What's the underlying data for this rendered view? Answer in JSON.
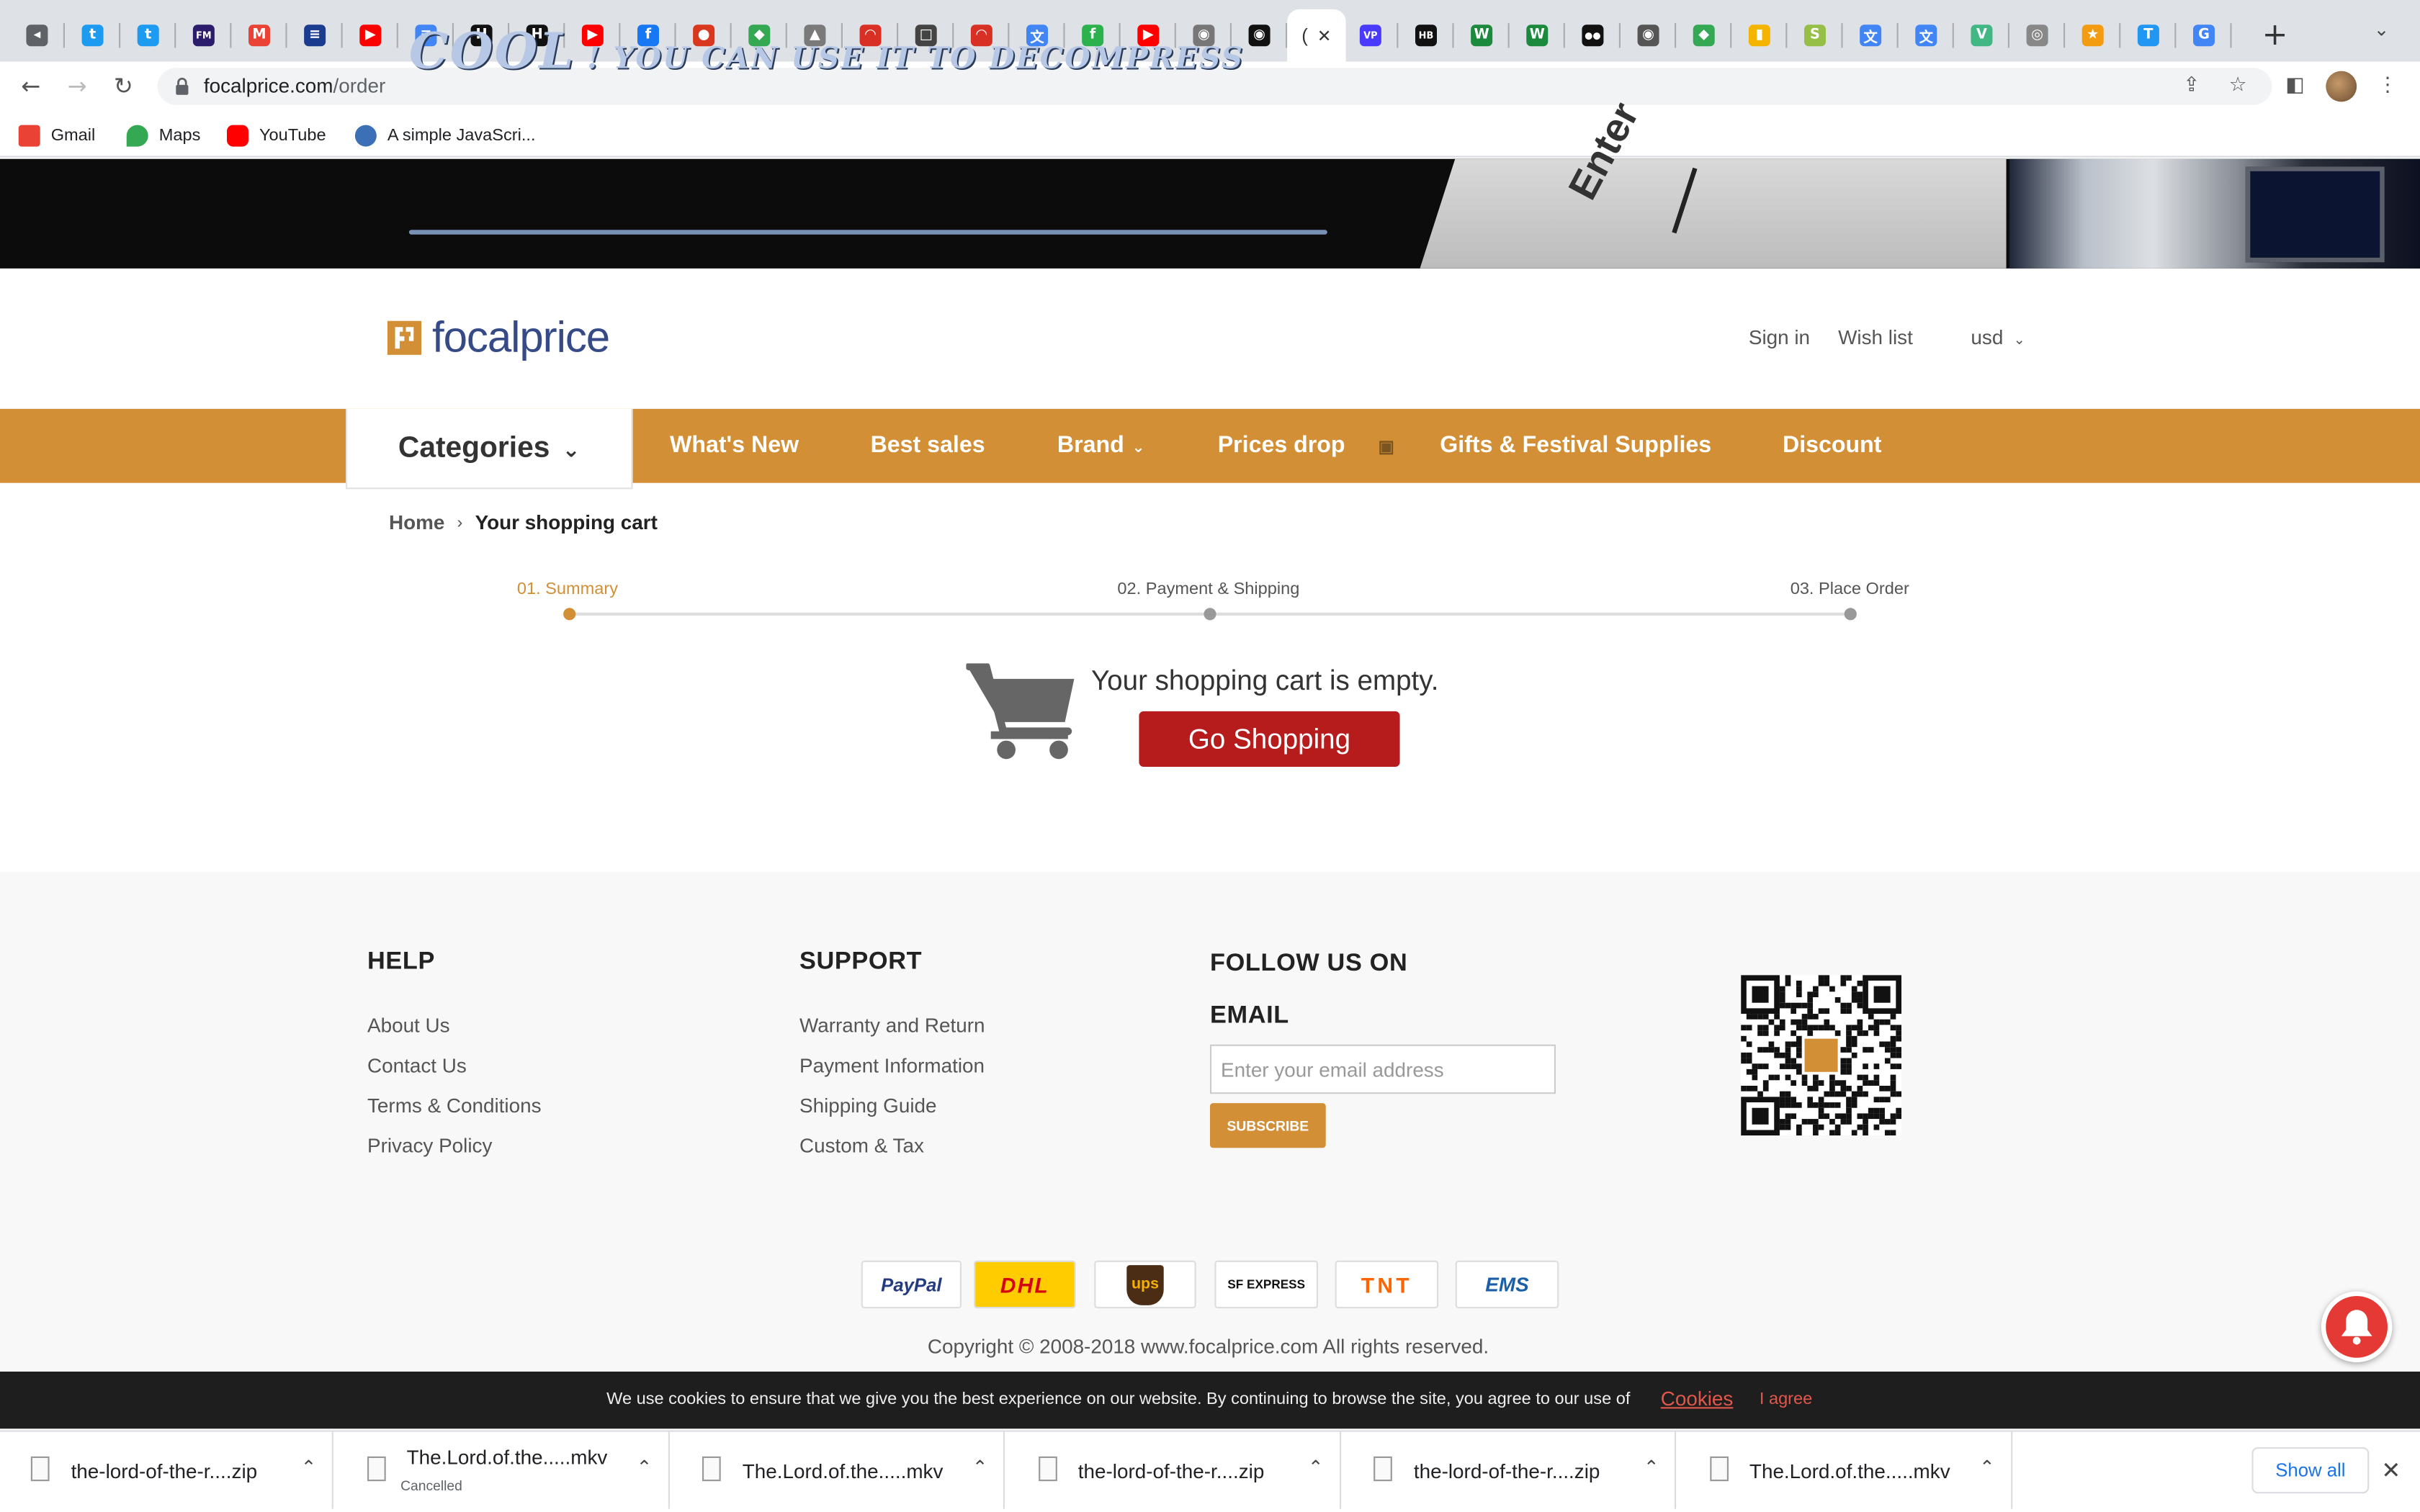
{
  "browser": {
    "url_domain": "focalprice.com",
    "url_path": "/order",
    "active_tab_label": "(",
    "tab_strip_first_label": "(",
    "new_tab_glyph": "+",
    "tab_menu_glyph": "⌄",
    "bookmarks": [
      {
        "label": "Gmail",
        "color": "#ea4335"
      },
      {
        "label": "Maps",
        "color": "#34a853"
      },
      {
        "label": "YouTube",
        "color": "#ff0000"
      },
      {
        "label": "A simple JavaScri...",
        "color": "#3b6fb6"
      }
    ],
    "tabs": [
      {
        "icon": "mute-icon",
        "color": "#5f6368",
        "glyph": "◂"
      },
      {
        "icon": "twitter-icon",
        "color": "#1d9bf0",
        "glyph": "t"
      },
      {
        "icon": "twitter-icon",
        "color": "#1d9bf0",
        "glyph": "t"
      },
      {
        "icon": "fm-icon",
        "color": "#2b1d6b",
        "glyph": "FM"
      },
      {
        "icon": "gmail-icon",
        "color": "#ea4335",
        "glyph": "M"
      },
      {
        "icon": "bank-icon",
        "color": "#1b3b8f",
        "glyph": "≡"
      },
      {
        "icon": "youtube-icon",
        "color": "#ff0000",
        "glyph": "▶"
      },
      {
        "icon": "docs-icon",
        "color": "#4285f4",
        "glyph": "≡"
      },
      {
        "icon": "hackernoon-icon",
        "color": "#111111",
        "glyph": "H"
      },
      {
        "icon": "hackernoon-icon",
        "color": "#111111",
        "glyph": "H"
      },
      {
        "icon": "youtube-icon",
        "color": "#ff0000",
        "glyph": "▶"
      },
      {
        "icon": "facebook-icon",
        "color": "#1877f2",
        "glyph": "f"
      },
      {
        "icon": "manutd-icon",
        "color": "#d9381e",
        "glyph": "●"
      },
      {
        "icon": "maps-icon",
        "color": "#34a853",
        "glyph": "◆"
      },
      {
        "icon": "image-icon",
        "color": "#7a7a7a",
        "glyph": "▲"
      },
      {
        "icon": "speedometer-icon",
        "color": "#d93025",
        "glyph": "◠"
      },
      {
        "icon": "square-icon",
        "color": "#444444",
        "glyph": "□"
      },
      {
        "icon": "speedometer-icon",
        "color": "#d93025",
        "glyph": "◠"
      },
      {
        "icon": "translate-icon",
        "color": "#4285f4",
        "glyph": "文"
      },
      {
        "icon": "feedly-icon",
        "color": "#2bb24c",
        "glyph": "f"
      },
      {
        "icon": "youtube-icon",
        "color": "#ff0000",
        "glyph": "▶"
      },
      {
        "icon": "globe-icon",
        "color": "#777777",
        "glyph": "◉"
      },
      {
        "icon": "github-icon",
        "color": "#111111",
        "glyph": "◉"
      },
      {
        "icon": "active-tab",
        "color": "#ffffff",
        "glyph": "("
      },
      {
        "icon": "vp-icon",
        "color": "#4a3aff",
        "glyph": "VP"
      },
      {
        "icon": "hb-icon",
        "color": "#111111",
        "glyph": "HB"
      },
      {
        "icon": "w-icon",
        "color": "#1c8a3c",
        "glyph": "W"
      },
      {
        "icon": "w-icon",
        "color": "#1c8a3c",
        "glyph": "W"
      },
      {
        "icon": "medium-icon",
        "color": "#111111",
        "glyph": "●●"
      },
      {
        "icon": "globe-icon",
        "color": "#555555",
        "glyph": "◉"
      },
      {
        "icon": "maps-icon",
        "color": "#34a853",
        "glyph": "◆"
      },
      {
        "icon": "shopping-bag-icon",
        "color": "#f4b400",
        "glyph": "▮"
      },
      {
        "icon": "shopify-icon",
        "color": "#95bf47",
        "glyph": "S"
      },
      {
        "icon": "translate-icon",
        "color": "#4285f4",
        "glyph": "文"
      },
      {
        "icon": "translate-icon",
        "color": "#4285f4",
        "glyph": "文"
      },
      {
        "icon": "vuejs-icon",
        "color": "#41b883",
        "glyph": "V"
      },
      {
        "icon": "video-icon",
        "color": "#888888",
        "glyph": "◎"
      },
      {
        "icon": "star-icon",
        "color": "#f39c12",
        "glyph": "★"
      },
      {
        "icon": "t-icon",
        "color": "#2196f3",
        "glyph": "T"
      },
      {
        "icon": "google-icon",
        "color": "#4285f4",
        "glyph": "G"
      }
    ]
  },
  "banner": {
    "headline_big": "COOL",
    "headline_rest": " !  YOU CAN USE IT TO DECOMPRESS",
    "key_label": "Enter"
  },
  "header": {
    "logo_text": "focalprice",
    "sign_in": "Sign in",
    "wish_list": "Wish list",
    "currency": "usd"
  },
  "nav": {
    "categories": "Categories",
    "items": [
      "What's New",
      "Best sales",
      "Brand",
      "Prices drop",
      "Gifts & Festival Supplies",
      "Discount"
    ]
  },
  "breadcrumb": {
    "home": "Home",
    "current": "Your shopping cart"
  },
  "steps": {
    "current_index": 0,
    "items": [
      "01. Summary",
      "02. Payment & Shipping",
      "03. Place Order"
    ],
    "active_color": "#d38f35"
  },
  "cart": {
    "empty_message": "Your shopping cart is empty.",
    "go_shopping": "Go Shopping"
  },
  "footer": {
    "help": {
      "heading": "HELP",
      "links": [
        "About Us",
        "Contact Us",
        "Terms & Conditions",
        "Privacy Policy"
      ]
    },
    "support": {
      "heading": "SUPPORT",
      "links": [
        "Warranty and Return",
        "Payment Information",
        "Shipping Guide",
        "Custom & Tax"
      ]
    },
    "follow": {
      "heading": "FOLLOW US ON",
      "email_heading": "EMAIL",
      "email_placeholder": "Enter your email address",
      "subscribe": "SUBSCRIBE"
    },
    "payment_logos": [
      "PayPal",
      "DHL",
      "ups",
      "SF EXPRESS",
      "TNT",
      "EMS"
    ],
    "copyright": "Copyright © 2008-2018 www.focalprice.com All rights reserved."
  },
  "cookie": {
    "text": "We use cookies to ensure that we give you the best experience on our website. By continuing to browse the site, you agree to our use of",
    "link": "Cookies",
    "agree": "I agree"
  },
  "downloads": {
    "items": [
      {
        "name": "the-lord-of-the-r....zip",
        "status": ""
      },
      {
        "name": "The.Lord.of.the.....mkv",
        "status": "Cancelled"
      },
      {
        "name": "The.Lord.of.the.....mkv",
        "status": ""
      },
      {
        "name": "the-lord-of-the-r....zip",
        "status": ""
      },
      {
        "name": "the-lord-of-the-r....zip",
        "status": ""
      },
      {
        "name": "The.Lord.of.the.....mkv",
        "status": ""
      }
    ],
    "show_all": "Show all"
  },
  "colors": {
    "brand_orange": "#d38f35",
    "button_red": "#b71c1c",
    "logo_blue": "#354a86"
  }
}
